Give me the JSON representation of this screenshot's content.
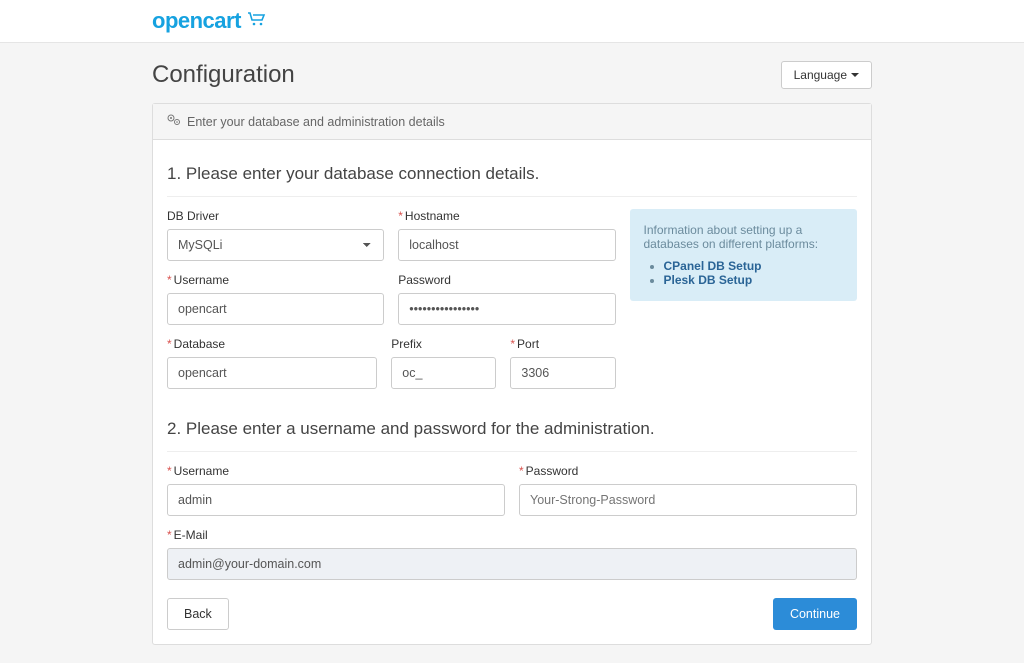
{
  "logo": {
    "text": "opencart"
  },
  "header": {
    "title": "Configuration",
    "language_label": "Language"
  },
  "panel": {
    "subtitle": "Enter your database and administration details"
  },
  "section1": {
    "title": "1. Please enter your database connection details.",
    "db_driver": {
      "label": "DB Driver",
      "value": "MySQLi"
    },
    "hostname": {
      "label": "Hostname",
      "value": "localhost"
    },
    "username": {
      "label": "Username",
      "value": "opencart"
    },
    "password": {
      "label": "Password",
      "value": "••••••••••••••••"
    },
    "database": {
      "label": "Database",
      "value": "opencart"
    },
    "prefix": {
      "label": "Prefix",
      "value": "oc_"
    },
    "port": {
      "label": "Port",
      "value": "3306"
    },
    "info": {
      "text": "Information about setting up a databases on different platforms:",
      "link1": "CPanel DB Setup",
      "link2": "Plesk DB Setup"
    }
  },
  "section2": {
    "title": "2. Please enter a username and password for the administration.",
    "username": {
      "label": "Username",
      "value": "admin"
    },
    "password": {
      "label": "Password",
      "placeholder": "Your-Strong-Password"
    },
    "email": {
      "label": "E-Mail",
      "value": "admin@your-domain.com"
    }
  },
  "actions": {
    "back": "Back",
    "continue": "Continue"
  }
}
